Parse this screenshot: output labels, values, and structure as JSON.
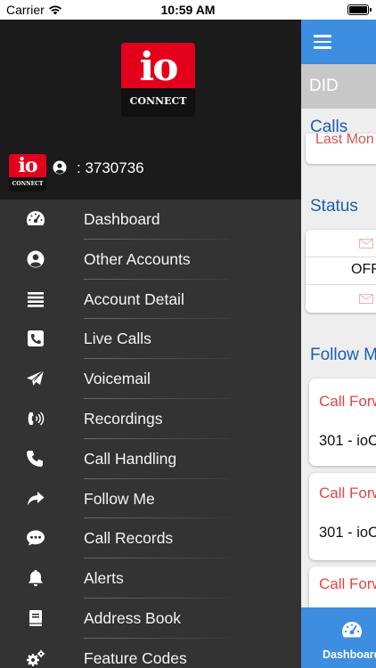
{
  "status_bar": {
    "carrier": "Carrier",
    "time": "10:59 AM"
  },
  "drawer": {
    "logo": {
      "top": "io",
      "bottom": "CONNECT"
    },
    "account_number": ": 3730736",
    "menu": [
      {
        "label": "Dashboard",
        "icon": "dashboard-icon"
      },
      {
        "label": "Other Accounts",
        "icon": "user-circle-icon"
      },
      {
        "label": "Account Detail",
        "icon": "list-icon"
      },
      {
        "label": "Live Calls",
        "icon": "phone-square-icon"
      },
      {
        "label": "Voicemail",
        "icon": "paper-plane-icon"
      },
      {
        "label": "Recordings",
        "icon": "phone-volume-icon"
      },
      {
        "label": "Call Handling",
        "icon": "phone-icon"
      },
      {
        "label": "Follow Me",
        "icon": "share-arrow-icon"
      },
      {
        "label": "Call Records",
        "icon": "comment-dots-icon"
      },
      {
        "label": "Alerts",
        "icon": "bell-icon"
      },
      {
        "label": "Address Book",
        "icon": "address-book-icon"
      },
      {
        "label": "Feature Codes",
        "icon": "gears-icon"
      }
    ]
  },
  "main": {
    "did_label": "DID",
    "calls_title": "Calls",
    "calls_card_text": "Last Mon",
    "status_title": "Status",
    "status_value": "OFF",
    "follow_title": "Follow M",
    "call_forward_cards": [
      {
        "title": "Call Forw",
        "number": "301 - ioC"
      },
      {
        "title": "Call Forw",
        "number": "301 - ioC"
      },
      {
        "title": "Call Forw",
        "number": ""
      }
    ],
    "bottom_tab_label": "Dashboard"
  },
  "colors": {
    "accent": "#3d8de0",
    "logo_red": "#e3001b",
    "drawer_bg": "#333333",
    "link_blue": "#1a5fb4",
    "alert_red": "#e04646"
  }
}
